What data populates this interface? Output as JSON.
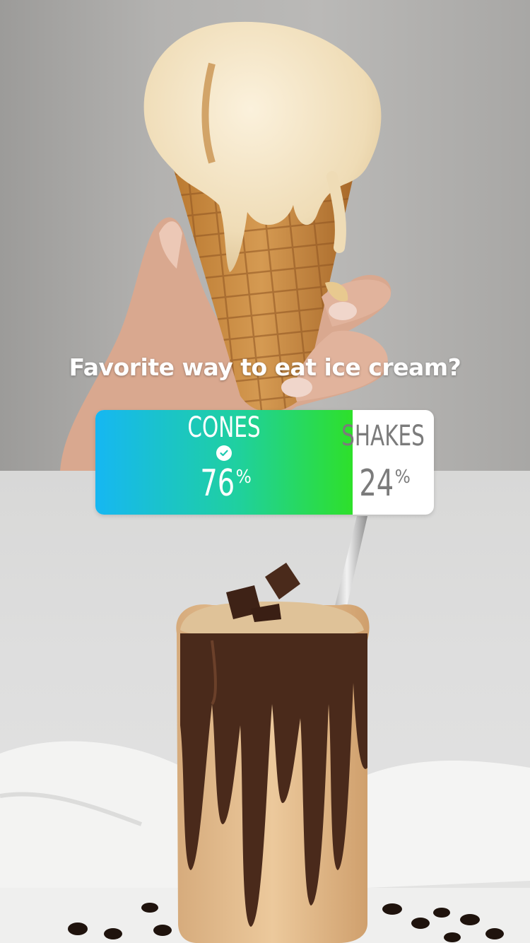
{
  "poll": {
    "question": "Favorite way to eat ice cream?",
    "options": [
      {
        "label": "CONES",
        "percent": "76",
        "percent_sign": "%",
        "selected": true,
        "fill_fraction": 0.76
      },
      {
        "label": "SHAKES",
        "percent": "24",
        "percent_sign": "%",
        "selected": false
      }
    ],
    "fill_gradient": [
      "#16b7f2",
      "#1fd0a0",
      "#2ee02a"
    ]
  },
  "icons": {
    "selected_check": "checkmark-circle-icon"
  }
}
